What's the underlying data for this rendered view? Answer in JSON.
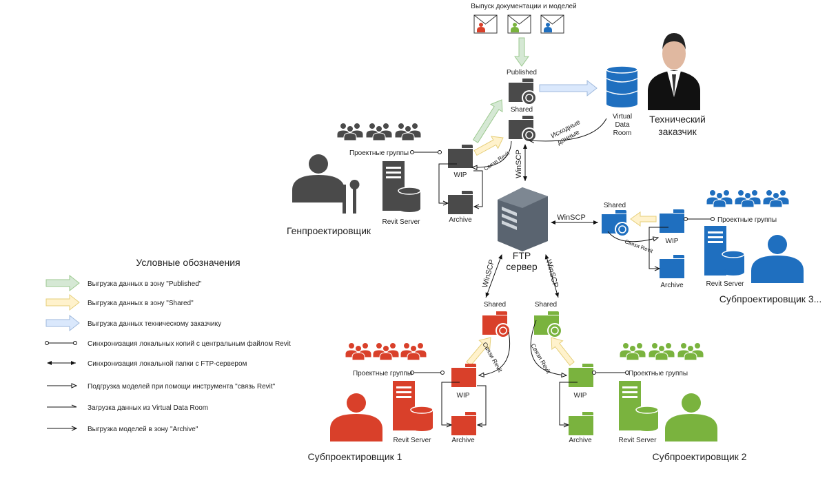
{
  "colors": {
    "dark": "#4a4a4a",
    "red": "#d9402a",
    "green": "#7ab33e",
    "blue": "#1f6fbf",
    "published_arrow": "#d5e8d4",
    "shared_arrow": "#fff2cc",
    "client_arrow": "#dae8fc"
  },
  "top": {
    "release_title": "Выпуск документации и моделей",
    "published": "Published",
    "shared": "Shared",
    "vdr_line1": "Virtual",
    "vdr_line2": "Data",
    "vdr_line3": "Room",
    "client_line1": "Технический",
    "client_line2": "заказчик",
    "source_line1": "Исходные",
    "source_line2": "данные"
  },
  "ftp": {
    "line1": "FTP",
    "line2": "сервер",
    "winscp": "WinSCP"
  },
  "general": {
    "name": "Генпроектировщик",
    "groups": "Проектные группы",
    "wip": "WIP",
    "archive": "Archive",
    "server": "Revit Server",
    "links": "Связи Revit"
  },
  "sub1": {
    "name": "Субпроектировщик 1",
    "groups": "Проектные группы",
    "wip": "WIP",
    "archive": "Archive",
    "server": "Revit Server",
    "shared": "Shared",
    "links": "Связи Revit"
  },
  "sub2": {
    "name": "Субпроектировщик 2",
    "groups": "Проектные группы",
    "wip": "WIP",
    "archive": "Archive",
    "server": "Revit Server",
    "shared": "Shared",
    "links": "Связи Revit"
  },
  "sub3": {
    "name": "Субпроектировщик 3...",
    "groups": "Проектные группы",
    "wip": "WIP",
    "archive": "Archive",
    "server": "Revit Server",
    "shared": "Shared",
    "links": "Связи Revit"
  },
  "legend": {
    "title": "Условные обозначения",
    "items": [
      {
        "label": "Выгрузка данных в зону \"Published\"",
        "icon": "green-block-arrow"
      },
      {
        "label": "Выгрузка данных в зону \"Shared\"",
        "icon": "yellow-block-arrow"
      },
      {
        "label": "Выгрузка данных техническому заказчику",
        "icon": "blue-block-arrow"
      },
      {
        "label": "Синхронизация локальных копий с центральным файлом Revit",
        "icon": "circle-ended-line"
      },
      {
        "label": "Синхронизация локальной папки с FTP-сервером",
        "icon": "double-arrow-line"
      },
      {
        "label": "Подгрузка моделей при помощи инструмента \"связь Revit\"",
        "icon": "open-triangle-arrow-line"
      },
      {
        "label": "Загрузка данных из Virtual Data Room",
        "icon": "half-arrow-line"
      },
      {
        "label": "Выгрузка моделей в зону \"Archive\"",
        "icon": "open-arrow-line"
      }
    ]
  }
}
